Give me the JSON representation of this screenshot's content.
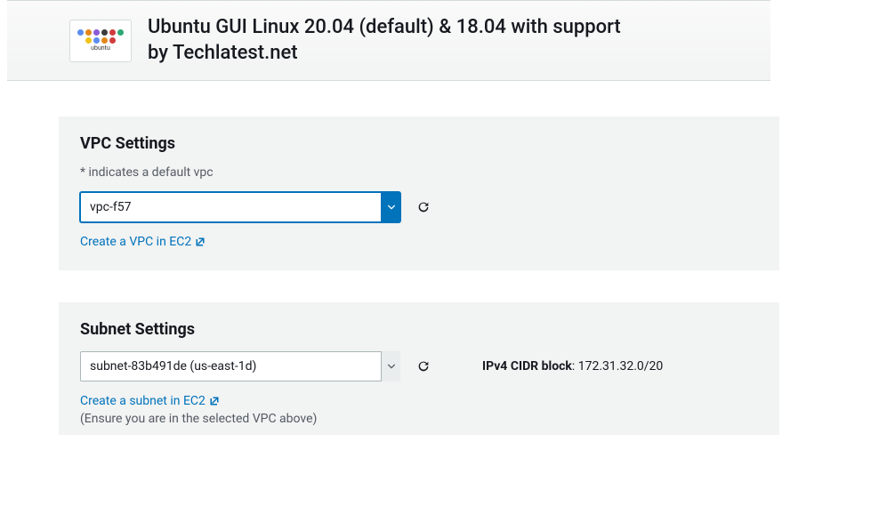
{
  "header": {
    "title": "Ubuntu GUI Linux 20.04 (default) & 18.04 with support by Techlatest.net",
    "logo_label": "ubuntu"
  },
  "vpc": {
    "heading": "VPC Settings",
    "hint": "* indicates a default vpc",
    "selected": "vpc-f57",
    "create_link": "Create a VPC in EC2"
  },
  "subnet": {
    "heading": "Subnet Settings",
    "selected": "subnet-83b491de (us-east-1d)",
    "create_link": "Create a subnet in EC2",
    "note": "(Ensure you are in the selected VPC above)",
    "cidr_label": "IPv4 CIDR block",
    "cidr_value": "172.31.32.0/20"
  }
}
